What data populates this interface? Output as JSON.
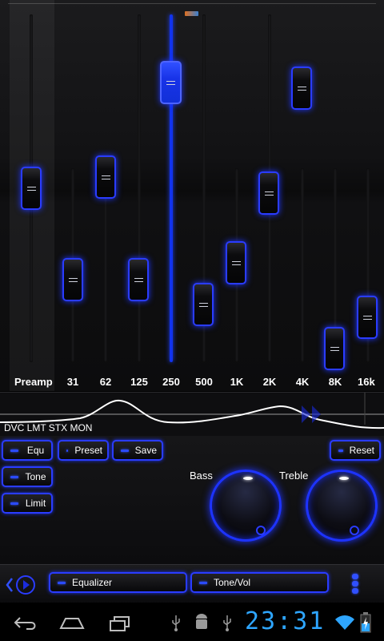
{
  "equalizer": {
    "bands": [
      "Preamp",
      "31",
      "62",
      "125",
      "250",
      "500",
      "1K",
      "2K",
      "4K",
      "8K",
      "16k"
    ]
  },
  "wave": {
    "status_text": "DVC LMT STX MON"
  },
  "left_buttons": {
    "equ": "Equ",
    "tone": "Tone",
    "limit": "Limit"
  },
  "action_buttons": {
    "preset": "Preset",
    "save": "Save",
    "reset": "Reset"
  },
  "knobs": {
    "bass_label": "Bass",
    "treble_label": "Treble"
  },
  "bottom_tabs": {
    "equalizer": "Equalizer",
    "tone_vol": "Tone/Vol"
  },
  "status_bar": {
    "time": "23:31"
  },
  "colors": {
    "accent": "#2a3cff",
    "clock": "#2ea6ff"
  }
}
